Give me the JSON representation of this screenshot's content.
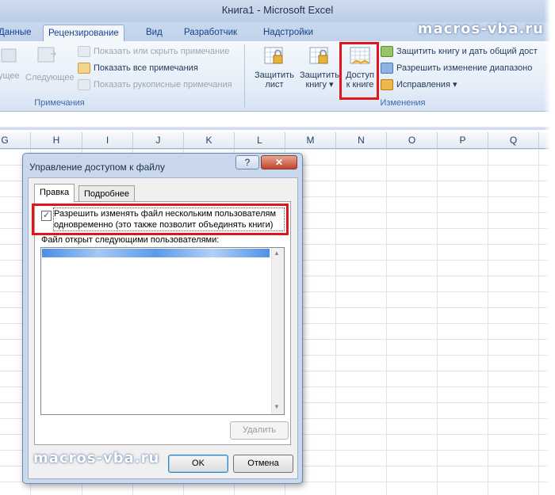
{
  "window": {
    "title": "Книга1 - Microsoft Excel"
  },
  "watermark": "macros-vba.ru",
  "ribbon_tabs": [
    {
      "label": "Данные"
    },
    {
      "label": "Рецензирование",
      "active": true
    },
    {
      "label": "Вид"
    },
    {
      "label": "Разработчик"
    },
    {
      "label": "Надстройки"
    }
  ],
  "comments_group": {
    "prev_label": "ущее",
    "next_label": "Следующее",
    "show_hide": "Показать или скрыть примечание",
    "show_all": "Показать все примечания",
    "show_ink": "Показать рукописные примечания",
    "label": "Примечания"
  },
  "changes_group": {
    "protect_sheet_1": "Защитить",
    "protect_sheet_2": "лист",
    "protect_book_1": "Защитить",
    "protect_book_2": "книгу ▾",
    "share_1": "Доступ",
    "share_2": "к книге",
    "protect_share": "Защитить книгу и дать общий дост",
    "allow_ranges": "Разрешить изменение диапазоно",
    "track_changes": "Исправления ▾",
    "label": "Изменения"
  },
  "columns": [
    "G",
    "H",
    "I",
    "J",
    "K",
    "L",
    "M",
    "N",
    "O",
    "P",
    "Q"
  ],
  "dialog": {
    "title": "Управление доступом к файлу",
    "help": "?",
    "close": "✕",
    "tabs": [
      {
        "label": "Правка",
        "active": true
      },
      {
        "label": "Подробнее"
      }
    ],
    "checkbox_checked": true,
    "checkbox_mark": "✓",
    "checkbox_label_line1": "Разрешить изменять файл нескольким пользователям",
    "checkbox_label_line2": "одновременно (это также позволит объединять книги)",
    "list_label": "Файл открыт следующими пользователями:",
    "remove_button": "Удалить",
    "ok_button": "OK",
    "cancel_button": "Отмена"
  },
  "colors": {
    "highlight": "#e0161e",
    "ribbon_text": "#15428b"
  }
}
